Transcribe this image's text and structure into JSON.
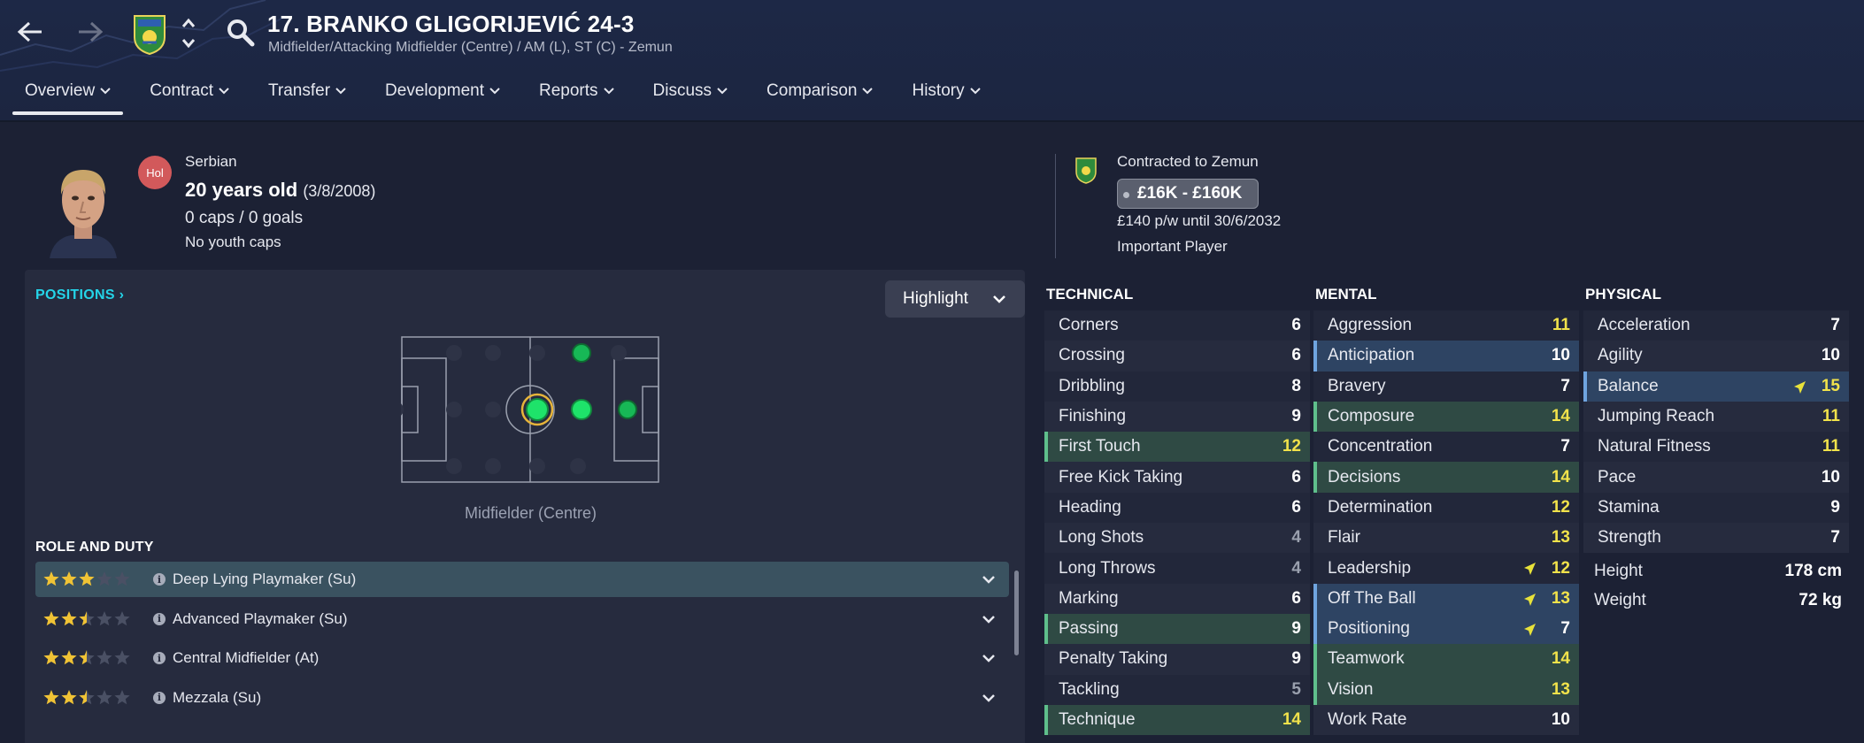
{
  "header": {
    "player_name": "17. BRANKO GLIGORIJEVIĆ 24-3",
    "player_subtitle": "Midfielder/Attacking Midfielder (Centre) / AM (L), ST (C) - Zemun"
  },
  "tabs": [
    {
      "label": "Overview",
      "active": true
    },
    {
      "label": "Contract"
    },
    {
      "label": "Transfer"
    },
    {
      "label": "Development"
    },
    {
      "label": "Reports"
    },
    {
      "label": "Discuss"
    },
    {
      "label": "Comparison"
    },
    {
      "label": "History"
    }
  ],
  "info": {
    "badge": "Hol",
    "nationality": "Serbian",
    "age": "20 years old",
    "dob": "(3/8/2008)",
    "caps": "0 caps / 0 goals",
    "youth_caps": "No youth caps",
    "contracted": "Contracted to Zemun",
    "value": "£16K - £160K",
    "wage": "£140 p/w until 30/6/2032",
    "status": "Important Player"
  },
  "positions": {
    "link": "POSITIONS",
    "highlight_label": "Highlight",
    "position_label": "Midfielder (Centre)"
  },
  "roles": {
    "title": "ROLE AND DUTY",
    "items": [
      {
        "name": "Deep Lying Playmaker (Su)",
        "stars": 3,
        "selected": true
      },
      {
        "name": "Advanced Playmaker (Su)",
        "stars": 2.5
      },
      {
        "name": "Central Midfielder (At)",
        "stars": 2.5
      },
      {
        "name": "Mezzala (Su)",
        "stars": 2.5
      }
    ]
  },
  "attributes": {
    "technical": {
      "title": "TECHNICAL",
      "items": [
        {
          "name": "Corners",
          "value": "6",
          "color": "white"
        },
        {
          "name": "Crossing",
          "value": "6",
          "color": "white"
        },
        {
          "name": "Dribbling",
          "value": "8",
          "color": "white"
        },
        {
          "name": "Finishing",
          "value": "9",
          "color": "white"
        },
        {
          "name": "First Touch",
          "value": "12",
          "color": "yellow",
          "highlight": "green"
        },
        {
          "name": "Free Kick Taking",
          "value": "6",
          "color": "white"
        },
        {
          "name": "Heading",
          "value": "6",
          "color": "white"
        },
        {
          "name": "Long Shots",
          "value": "4",
          "color": "grey"
        },
        {
          "name": "Long Throws",
          "value": "4",
          "color": "grey"
        },
        {
          "name": "Marking",
          "value": "6",
          "color": "white"
        },
        {
          "name": "Passing",
          "value": "9",
          "color": "white",
          "highlight": "green"
        },
        {
          "name": "Penalty Taking",
          "value": "9",
          "color": "white"
        },
        {
          "name": "Tackling",
          "value": "5",
          "color": "grey"
        },
        {
          "name": "Technique",
          "value": "14",
          "color": "yellow",
          "highlight": "green"
        }
      ]
    },
    "mental": {
      "title": "MENTAL",
      "items": [
        {
          "name": "Aggression",
          "value": "11",
          "color": "yellow"
        },
        {
          "name": "Anticipation",
          "value": "10",
          "color": "white",
          "highlight": "blue"
        },
        {
          "name": "Bravery",
          "value": "7",
          "color": "white"
        },
        {
          "name": "Composure",
          "value": "14",
          "color": "yellow",
          "highlight": "green"
        },
        {
          "name": "Concentration",
          "value": "7",
          "color": "white"
        },
        {
          "name": "Decisions",
          "value": "14",
          "color": "yellow",
          "highlight": "green"
        },
        {
          "name": "Determination",
          "value": "12",
          "color": "yellow"
        },
        {
          "name": "Flair",
          "value": "13",
          "color": "yellow"
        },
        {
          "name": "Leadership",
          "value": "12",
          "color": "yellow",
          "arrow": true
        },
        {
          "name": "Off The Ball",
          "value": "13",
          "color": "yellow",
          "highlight": "blue",
          "arrow": true
        },
        {
          "name": "Positioning",
          "value": "7",
          "color": "white",
          "highlight": "blue",
          "arrow": true
        },
        {
          "name": "Teamwork",
          "value": "14",
          "color": "yellow",
          "highlight": "green"
        },
        {
          "name": "Vision",
          "value": "13",
          "color": "yellow",
          "highlight": "green"
        },
        {
          "name": "Work Rate",
          "value": "10",
          "color": "white"
        }
      ]
    },
    "physical": {
      "title": "PHYSICAL",
      "items": [
        {
          "name": "Acceleration",
          "value": "7",
          "color": "white"
        },
        {
          "name": "Agility",
          "value": "10",
          "color": "white"
        },
        {
          "name": "Balance",
          "value": "15",
          "color": "yellow",
          "highlight": "blue",
          "arrow": true
        },
        {
          "name": "Jumping Reach",
          "value": "11",
          "color": "yellow"
        },
        {
          "name": "Natural Fitness",
          "value": "11",
          "color": "yellow"
        },
        {
          "name": "Pace",
          "value": "10",
          "color": "white"
        },
        {
          "name": "Stamina",
          "value": "9",
          "color": "white"
        },
        {
          "name": "Strength",
          "value": "7",
          "color": "white"
        }
      ],
      "height_label": "Height",
      "height_value": "178 cm",
      "weight_label": "Weight",
      "weight_value": "72 kg"
    }
  },
  "colors": {
    "accent_cyan": "#24d4e8",
    "attr_yellow": "#f1e24b",
    "highlight_green": "#2f4a44",
    "highlight_blue": "#2e4463",
    "position_green": "#1ee36a"
  }
}
